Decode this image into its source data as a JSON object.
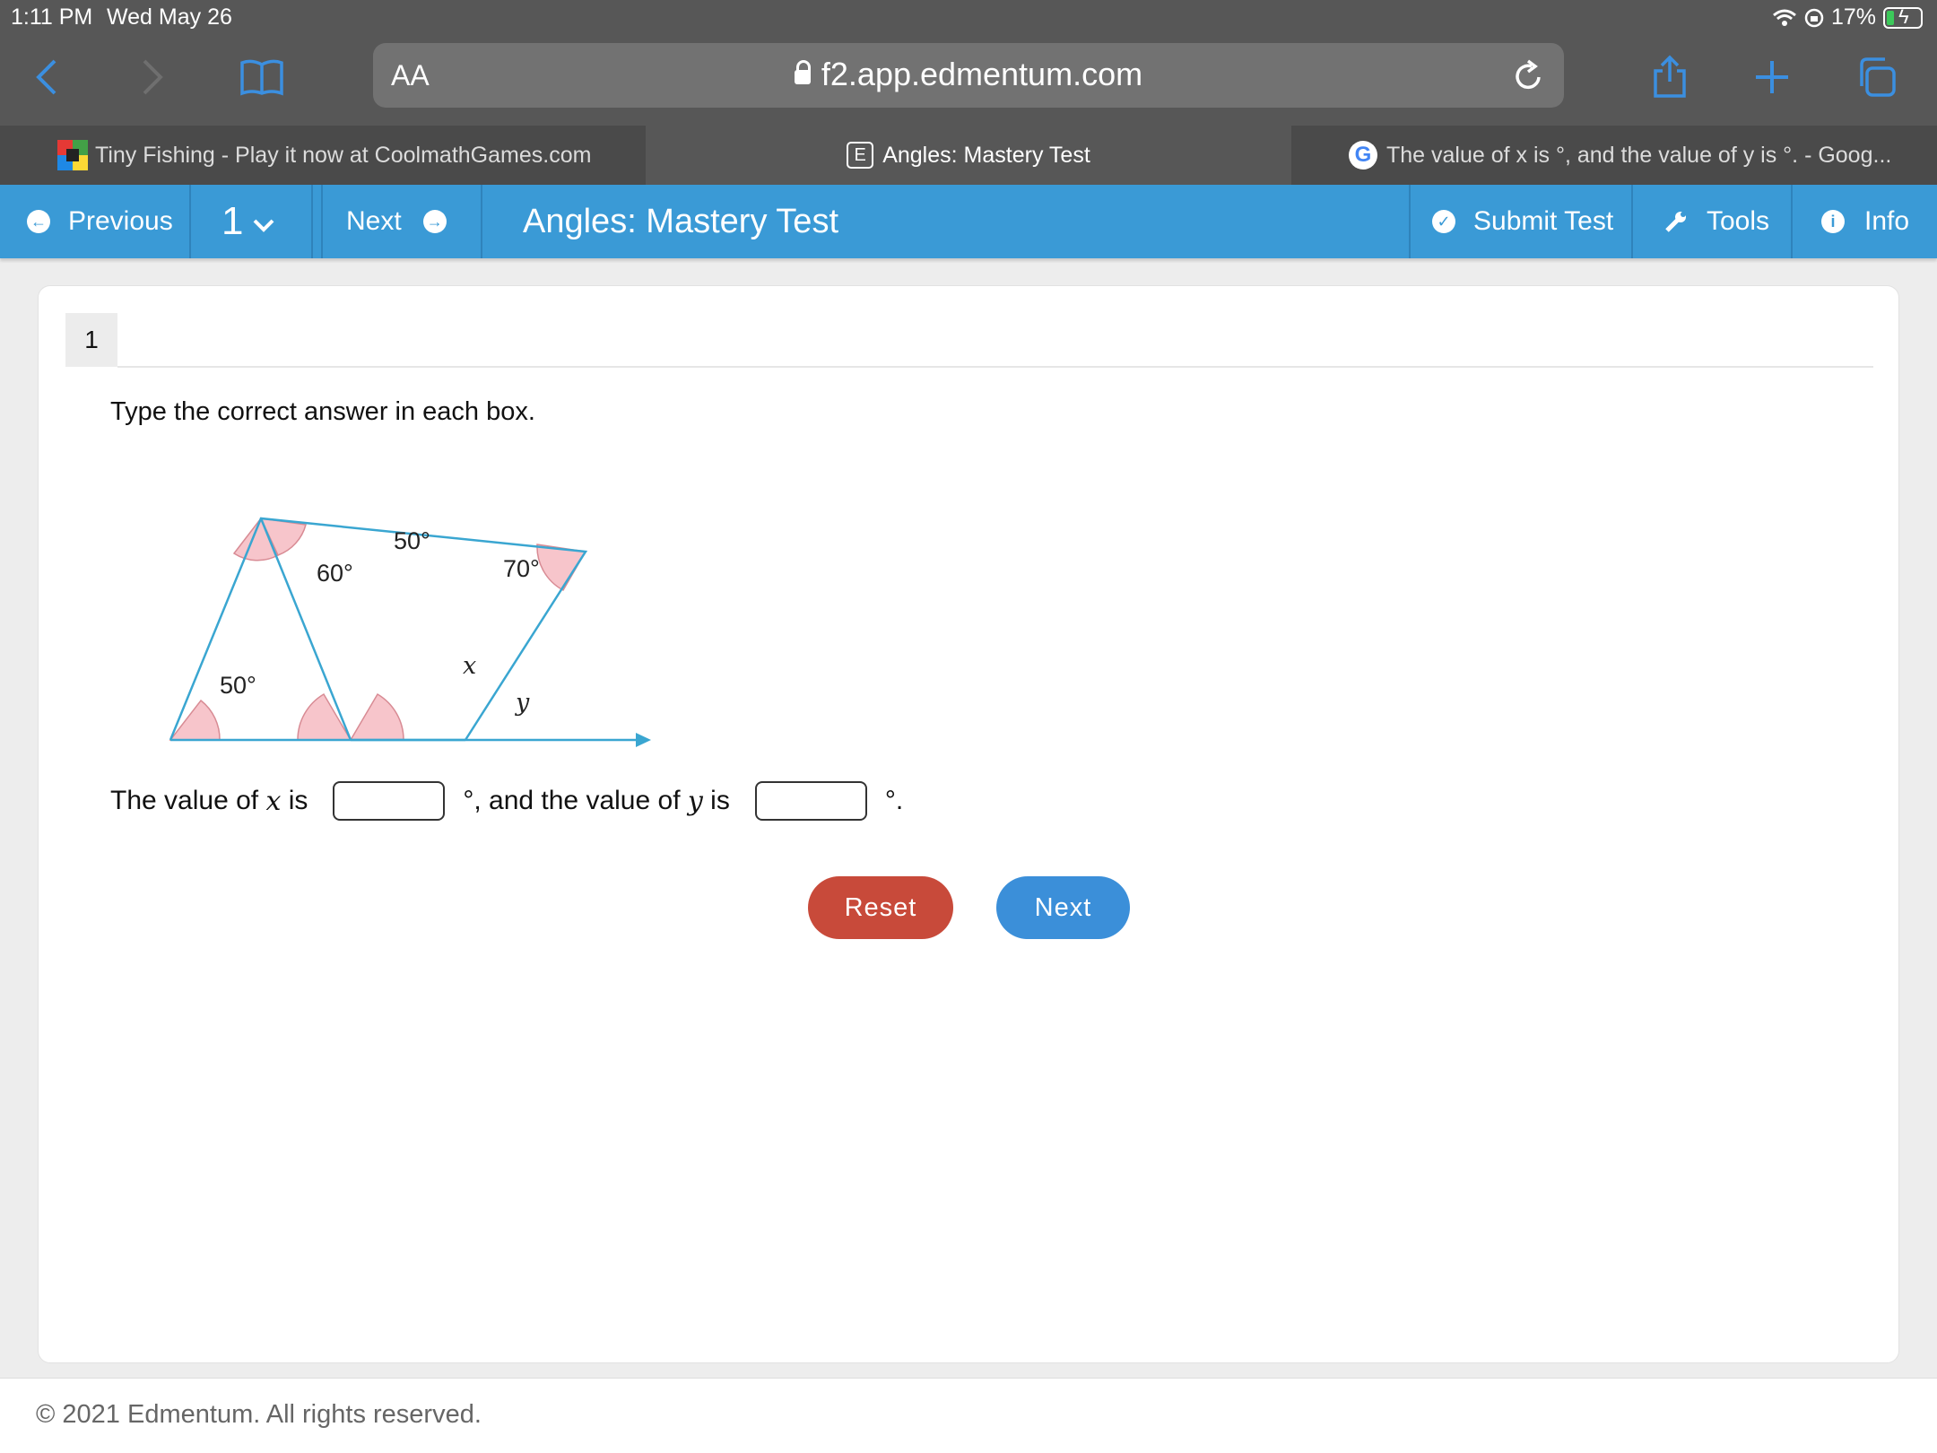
{
  "status": {
    "time": "1:11 PM",
    "date": "Wed May 26",
    "battery": "17%"
  },
  "browser": {
    "aa": "AA",
    "url": "f2.app.edmentum.com",
    "tabs": [
      {
        "title": "Tiny Fishing - Play it now at CoolmathGames.com"
      },
      {
        "title": "Angles: Mastery Test",
        "badge": "E"
      },
      {
        "title": "The value of x is °, and the value of y is °. - Goog..."
      }
    ]
  },
  "appnav": {
    "previous": "Previous",
    "question_number": "1",
    "next": "Next",
    "title": "Angles: Mastery Test",
    "submit": "Submit Test",
    "tools": "Tools",
    "info": "Info"
  },
  "question": {
    "number": "1",
    "instruction": "Type the correct answer in each box.",
    "figure": {
      "angle_top_right": "50°",
      "angle_top_left": "60°",
      "angle_right": "70°",
      "angle_bottom_left": "50°",
      "label_x": "x",
      "label_y": "y"
    },
    "answer": {
      "part1": "The value of ",
      "x": "x",
      "part2": " is",
      "part3": "°, and the value of ",
      "y": "y",
      "part4": " is",
      "part5": "°.",
      "x_value": "",
      "y_value": ""
    },
    "reset_label": "Reset",
    "next_label": "Next"
  },
  "footer": {
    "copyright": "© 2021 Edmentum. All rights reserved."
  },
  "colors": {
    "nav_blue": "#3a9ad6",
    "reset_red": "#c84a3a",
    "next_blue": "#3b8fd9",
    "figure_line": "#3aa6d1",
    "angle_fill": "#f7c5cb"
  }
}
